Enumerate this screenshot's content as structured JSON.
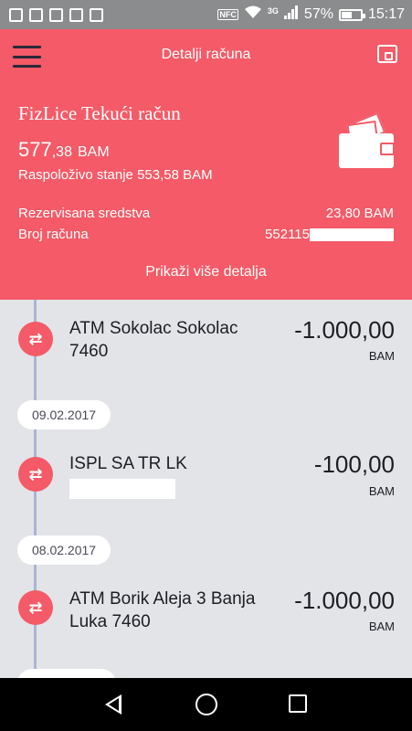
{
  "status_bar": {
    "nfc_label": "NFC",
    "network_label": "3G",
    "battery_percent": "57%",
    "battery_level": 0.57,
    "time": "15:17"
  },
  "header": {
    "title": "Detalji računa",
    "account_name": "FizLice Tekući račun",
    "balance_main": "577",
    "balance_decimal": ",38",
    "balance_currency": "BAM",
    "available": "Raspoloživo stanje 553,58 BAM",
    "reserved_label": "Rezervisana sredstva",
    "reserved_value": "23,80 BAM",
    "account_number_label": "Broj računa",
    "account_number_visible": "552115",
    "more_details": "Prikaži više detalja"
  },
  "transactions": [
    {
      "title": "ATM Sokolac Sokolac 7460",
      "amount": "-1.000,00",
      "currency": "BAM"
    },
    {
      "date": "09.02.2017"
    },
    {
      "title": "ISPL SA TR LK",
      "amount": "-100,00",
      "currency": "BAM"
    },
    {
      "date": "08.02.2017"
    },
    {
      "title": "ATM Borik Aleja 3 Banja Luka 7460",
      "amount": "-1.000,00",
      "currency": "BAM"
    }
  ],
  "list": {
    "tx1": {
      "title": "ATM Sokolac Sokolac 7460",
      "amount": "-1.000,00",
      "currency": "BAM"
    },
    "date1": "09.02.2017",
    "tx2": {
      "title": "ISPL SA TR LK",
      "amount": "-100,00",
      "currency": "BAM"
    },
    "date2": "08.02.2017",
    "tx3": {
      "title": "ATM Borik Aleja 3 Banja Luka 7460",
      "amount": "-1.000,00",
      "currency": "BAM"
    }
  },
  "icons": {
    "transfer": "⇄"
  },
  "colors": {
    "accent": "#f45a67",
    "list_bg": "#e3e4e8",
    "timeline": "#aab4d8"
  }
}
